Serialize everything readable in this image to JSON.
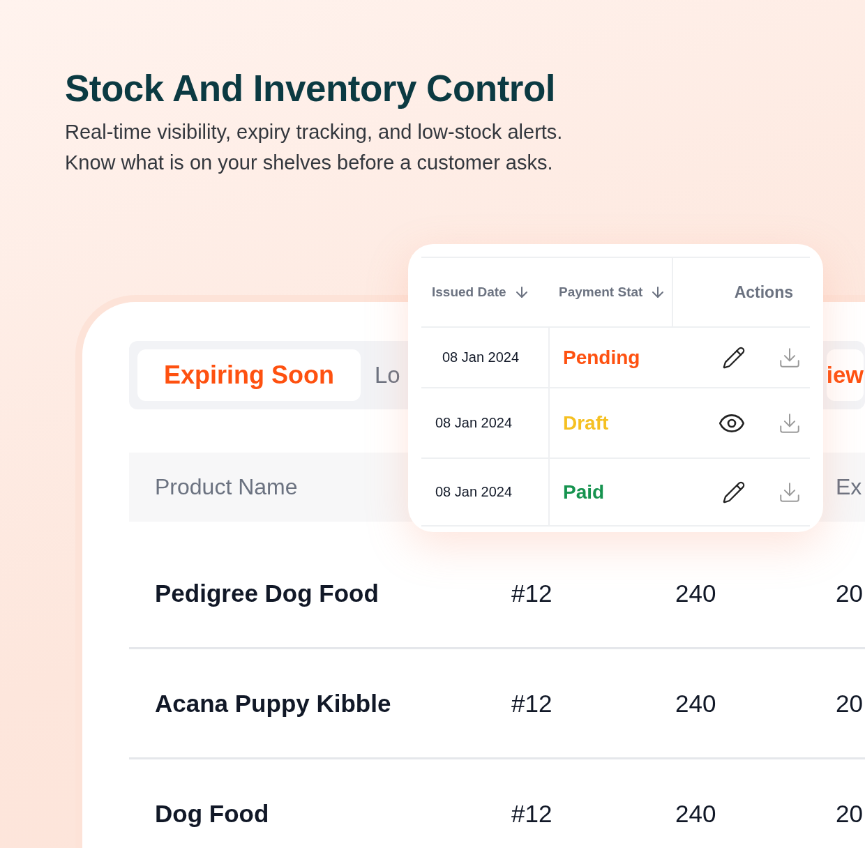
{
  "hero": {
    "title": "Stock And Inventory Control",
    "subtitle_lines": [
      "Real-time visibility, expiry tracking, and low-stock alerts.",
      "Know what is on your shelves before a customer asks."
    ]
  },
  "inventory_card": {
    "tabs": [
      {
        "label": "Expiring Soon",
        "selected": true
      },
      {
        "label": "Lo",
        "selected": false
      },
      {
        "label": "iew",
        "selected": true
      }
    ],
    "columns": [
      {
        "label": "Product Name"
      },
      {},
      {},
      {
        "label": "Ex"
      }
    ],
    "rows": [
      [
        "Pedigree Dog Food",
        "#12",
        "240",
        "20"
      ],
      [
        "Acana Puppy Kibble",
        "#12",
        "240",
        "20"
      ],
      [
        "Dog Food",
        "#12",
        "240",
        "20"
      ]
    ]
  },
  "payments_card": {
    "columns": [
      {
        "label": "Issued Date",
        "sort_arrow": true
      },
      {
        "label": "Payment Stat",
        "sort_arrow": true
      },
      {
        "label": "Actions",
        "sort_arrow": false
      }
    ],
    "rows": [
      {
        "date": "08 Jan 2024",
        "status": "Pending",
        "color": "#fe5110",
        "kind": "edit"
      },
      {
        "date": "08 Jan 2024",
        "status": "Draft",
        "color": "#f5c022",
        "kind": "view"
      },
      {
        "date": "08 Jan 2024",
        "status": "Paid",
        "color": "#16934f",
        "kind": "edit"
      }
    ]
  }
}
